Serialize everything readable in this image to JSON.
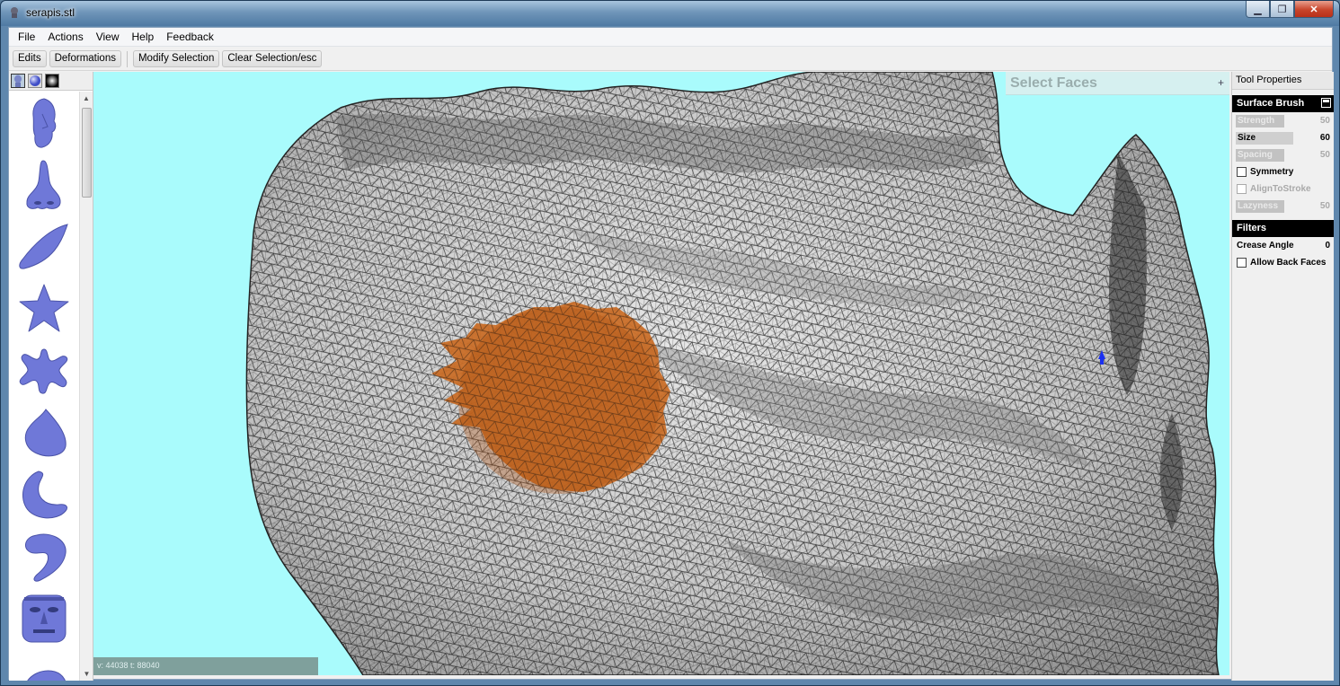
{
  "window": {
    "title": "serapis.stl"
  },
  "menu": [
    "File",
    "Actions",
    "View",
    "Help",
    "Feedback"
  ],
  "toolbar": {
    "edits": "Edits",
    "deformations": "Deformations",
    "modify_selection": "Modify Selection",
    "clear_selection": "Clear Selection/esc"
  },
  "palette": {
    "tabs": [
      "head-tab-icon",
      "sphere-tab-icon",
      "texture-tab-icon"
    ],
    "items": [
      "face-shape-icon",
      "nose-shape-icon",
      "leaf-shape-icon",
      "star-shape-icon",
      "splat-shape-icon",
      "cone-shape-icon",
      "bean-shape-icon",
      "hook-shape-icon",
      "mask-shape-icon",
      "blob-shape-icon"
    ]
  },
  "viewport": {
    "tool_title": "Select Faces",
    "plus": "+",
    "stats": "v: 44038  t: 88040",
    "background_color": "#a9fbfc",
    "selection_color": "#c8651a"
  },
  "properties": {
    "header": "Tool Properties",
    "brush_section": "Surface Brush",
    "strength_label": "Strength",
    "strength_value": "50",
    "size_label": "Size",
    "size_value": "60",
    "spacing_label": "Spacing",
    "spacing_value": "50",
    "symmetry_label": "Symmetry",
    "align_label": "AlignToStroke",
    "lazyness_label": "Lazyness",
    "lazyness_value": "50",
    "filters_section": "Filters",
    "crease_label": "Crease Angle",
    "crease_value": "0",
    "backfaces_label": "Allow Back Faces"
  }
}
